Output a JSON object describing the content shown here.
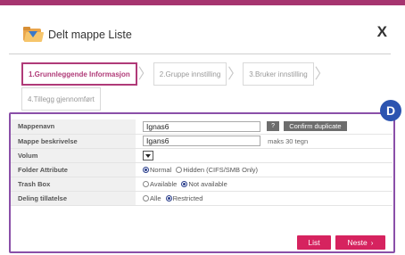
{
  "dialog": {
    "title": "Delt mappe Liste",
    "close_label": "X"
  },
  "steps": [
    {
      "label": "1.Grunnleggende Informasjon",
      "active": true
    },
    {
      "label": "2.Gruppe innstilling",
      "active": false
    },
    {
      "label": "3.Bruker innstilling",
      "active": false
    },
    {
      "label": "4.Tillegg gjennomført",
      "active": false
    }
  ],
  "badge": "D",
  "form": {
    "name": {
      "label": "Mappenavn",
      "value": "Ignas6",
      "help_label": "?",
      "confirm_label": "Confirm duplicate"
    },
    "description": {
      "label": "Mappe beskrivelse",
      "value": "Igans6",
      "hint": "maks 30 tegn"
    },
    "volume": {
      "label": "Volum"
    },
    "folder_attribute": {
      "label": "Folder Attribute",
      "options": [
        "Normal",
        "Hidden (CIFS/SMB Only)"
      ],
      "selected": "Normal"
    },
    "trash_box": {
      "label": "Trash Box",
      "options": [
        "Available",
        "Not available"
      ],
      "selected": "Not available"
    },
    "sharing": {
      "label": "Deling tillatelse",
      "options": [
        "Alle",
        "Restricted"
      ],
      "selected": "Restricted"
    }
  },
  "buttons": {
    "list": "List",
    "next": "Neste",
    "next_icon": "›"
  },
  "colors": {
    "accent": "#a6346f",
    "button": "#d6235f",
    "badge": "#2c54b0"
  }
}
